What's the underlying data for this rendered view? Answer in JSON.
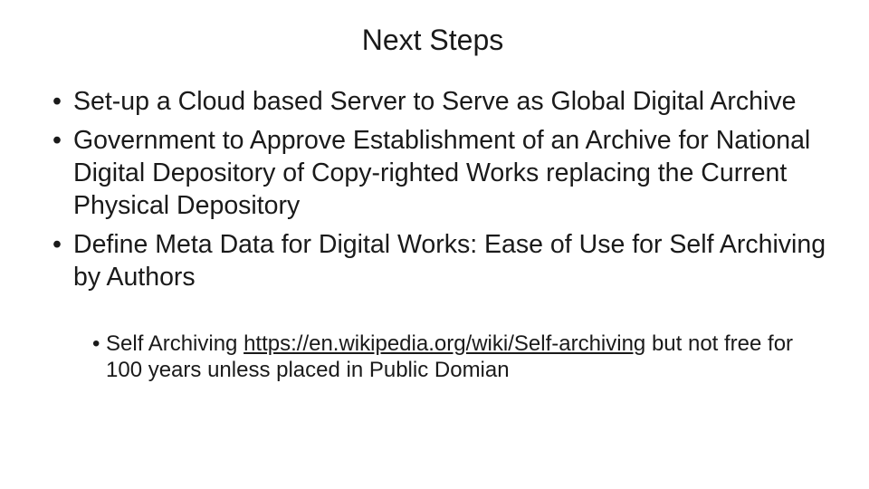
{
  "slide": {
    "title": "Next Steps",
    "bullets": [
      "Set-up a Cloud based Server to Serve as Global Digital Archive",
      "Government to Approve Establishment of an Archive for National Digital Depository of Copy-righted Works replacing the Current Physical Depository",
      "Define Meta Data for Digital Works: Ease of Use for Self Archiving by Authors"
    ],
    "sub_bullet": {
      "prefix": "Self Archiving ",
      "link_text": "https://en.wikipedia.org/wiki/Self-archiving",
      "suffix": " but not free for 100 years unless placed in Public Domian"
    }
  }
}
